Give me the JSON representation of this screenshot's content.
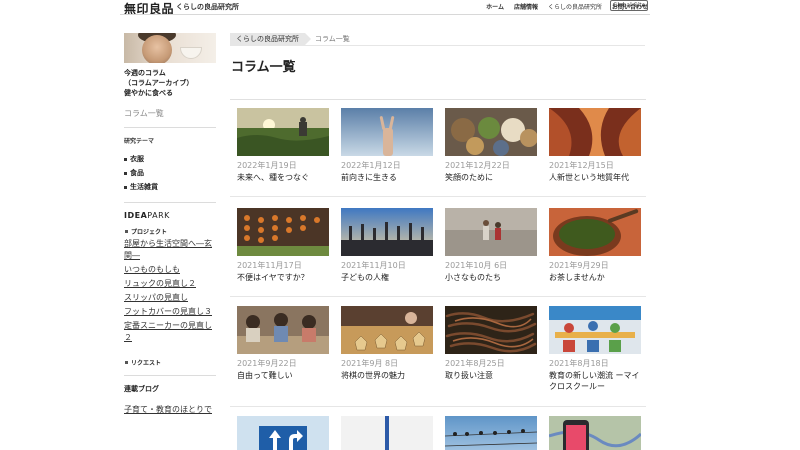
{
  "header": {
    "brand": "無印良品",
    "subtitle": "くらしの良品研究所",
    "nav": [
      "ホーム",
      "店舗情報",
      "くらしの良品研究所",
      "お問い合わせ"
    ],
    "global_button": "Global Site"
  },
  "sidebar": {
    "week_label_1": "今週のコラム",
    "week_label_2": "（コラムアーカイブ）",
    "week_title": "健やかに食べる",
    "archive_label": "コラム一覧",
    "theme_heading": "研究テーマ",
    "themes": [
      "衣服",
      "食品",
      "生活雑貨"
    ],
    "idea_bold": "IDEA",
    "idea_thin": "PARK",
    "project_heading": "プロジェクト",
    "projects": [
      "部屋から生活空間へ―玄関―",
      "いつものもしも",
      "リュックの見直し２",
      "スリッパの見直し",
      "フットカバーの見直し３",
      "定番スニーカーの見直し２"
    ],
    "request_heading": "リクエスト",
    "blog_heading": "連載ブログ",
    "blog_link": "子育て・教育のほとりで"
  },
  "breadcrumb": {
    "parent": "くらしの良品研究所",
    "current": "コラム一覧"
  },
  "page_title": "コラム一覧",
  "columns": [
    {
      "date": "2022年1月19日",
      "title": "未来へ、種をつなぐ",
      "thumb": "field-sunset"
    },
    {
      "date": "2022年1月12日",
      "title": "前向きに生きる",
      "thumb": "peace-hand-sky"
    },
    {
      "date": "2021年12月22日",
      "title": "笑顔のために",
      "thumb": "teddy-bears"
    },
    {
      "date": "2021年12月15日",
      "title": "人新世という地質年代",
      "thumb": "red-canyon"
    },
    {
      "date": "2021年11月17日",
      "title": "不便はイヤですか？",
      "thumb": "hanging-persimmons"
    },
    {
      "date": "2021年11月10日",
      "title": "子どもの人権",
      "thumb": "raised-hands"
    },
    {
      "date": "2021年10月 6日",
      "title": "小さなものたち",
      "thumb": "children-walking"
    },
    {
      "date": "2021年9月29日",
      "title": "お茶しませんか",
      "thumb": "green-tea-bowl"
    },
    {
      "date": "2021年9月22日",
      "title": "自由って難しい",
      "thumb": "classroom-kids"
    },
    {
      "date": "2021年9月 8日",
      "title": "将棋の世界の魅力",
      "thumb": "shogi-board"
    },
    {
      "date": "2021年8月25日",
      "title": "取り扱い注意",
      "thumb": "worms"
    },
    {
      "date": "2021年8月18日",
      "title": "教育の新しい潮流 ーマイクロスクールー",
      "thumb": "micro-school"
    },
    {
      "date": "",
      "title": "",
      "thumb": "road-sign"
    },
    {
      "date": "",
      "title": "",
      "thumb": "pen-white"
    },
    {
      "date": "",
      "title": "",
      "thumb": "birds-wire"
    },
    {
      "date": "",
      "title": "",
      "thumb": "phone-map"
    }
  ]
}
